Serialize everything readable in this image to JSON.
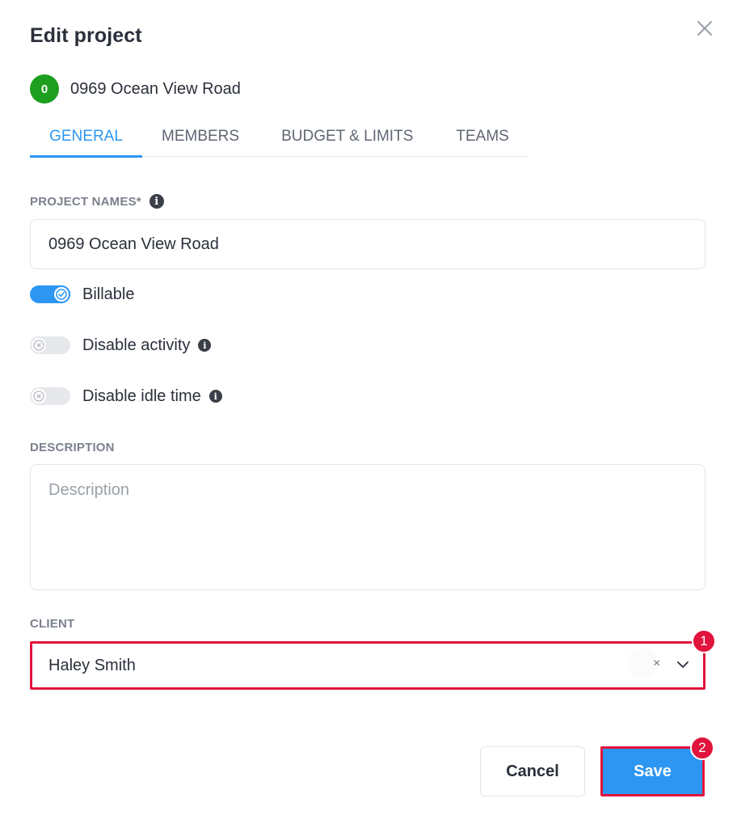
{
  "dialog": {
    "title": "Edit project",
    "close_icon": "close-icon"
  },
  "project": {
    "avatar_text": "0",
    "avatar_color": "#1e9e1e",
    "name": "0969 Ocean View Road"
  },
  "tabs": [
    {
      "label": "GENERAL",
      "active": true
    },
    {
      "label": "MEMBERS",
      "active": false
    },
    {
      "label": "BUDGET & LIMITS",
      "active": false
    },
    {
      "label": "TEAMS",
      "active": false
    }
  ],
  "form": {
    "project_names_label": "PROJECT NAMES*",
    "project_names_value": "0969 Ocean View Road",
    "toggles": [
      {
        "label": "Billable",
        "on": true,
        "info": false
      },
      {
        "label": "Disable activity",
        "on": false,
        "info": true
      },
      {
        "label": "Disable idle time",
        "on": false,
        "info": true
      }
    ],
    "description_label": "DESCRIPTION",
    "description_placeholder": "Description",
    "client_label": "CLIENT",
    "client_value": "Haley Smith",
    "clear_symbol": "×"
  },
  "actions": {
    "cancel_label": "Cancel",
    "save_label": "Save"
  },
  "markers": [
    "1",
    "2"
  ],
  "colors": {
    "accent": "#2d96f2",
    "highlight": "#e0143c",
    "avatar": "#1e9e1e"
  }
}
